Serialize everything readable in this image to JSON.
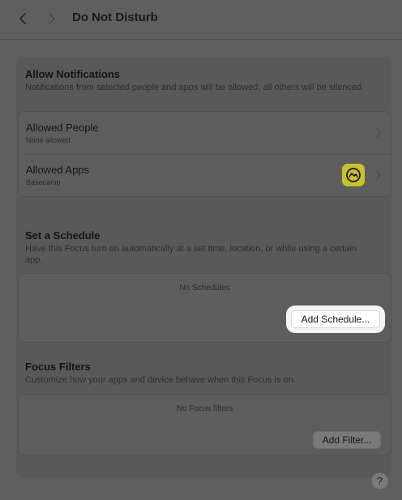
{
  "toolbar": {
    "back_icon": "chevron-left-icon",
    "forward_icon": "chevron-right-icon",
    "title": "Do Not Disturb"
  },
  "allow_notifications": {
    "title": "Allow Notifications",
    "description": "Notifications from selected people and apps will be allowed, all others will be silenced.",
    "rows": [
      {
        "title": "Allowed People",
        "subtitle": "None allowed"
      },
      {
        "title": "Allowed Apps",
        "subtitle": "Basecamp",
        "icon": "basecamp-icon"
      }
    ]
  },
  "schedule": {
    "title": "Set a Schedule",
    "description": "Have this Focus turn on automatically at a set time, location, or while using a certain app.",
    "empty_label": "No Schedules",
    "add_button": "Add Schedule..."
  },
  "focus_filters": {
    "title": "Focus Filters",
    "description": "Customize how your apps and device behave when this Focus is on.",
    "empty_label": "No Focus filters",
    "add_button": "Add Filter..."
  },
  "help": {
    "label": "?"
  },
  "colors": {
    "background": "#5f5f5f",
    "highlight": "#ffffff",
    "basecamp_yellow": "#c9c22a"
  }
}
